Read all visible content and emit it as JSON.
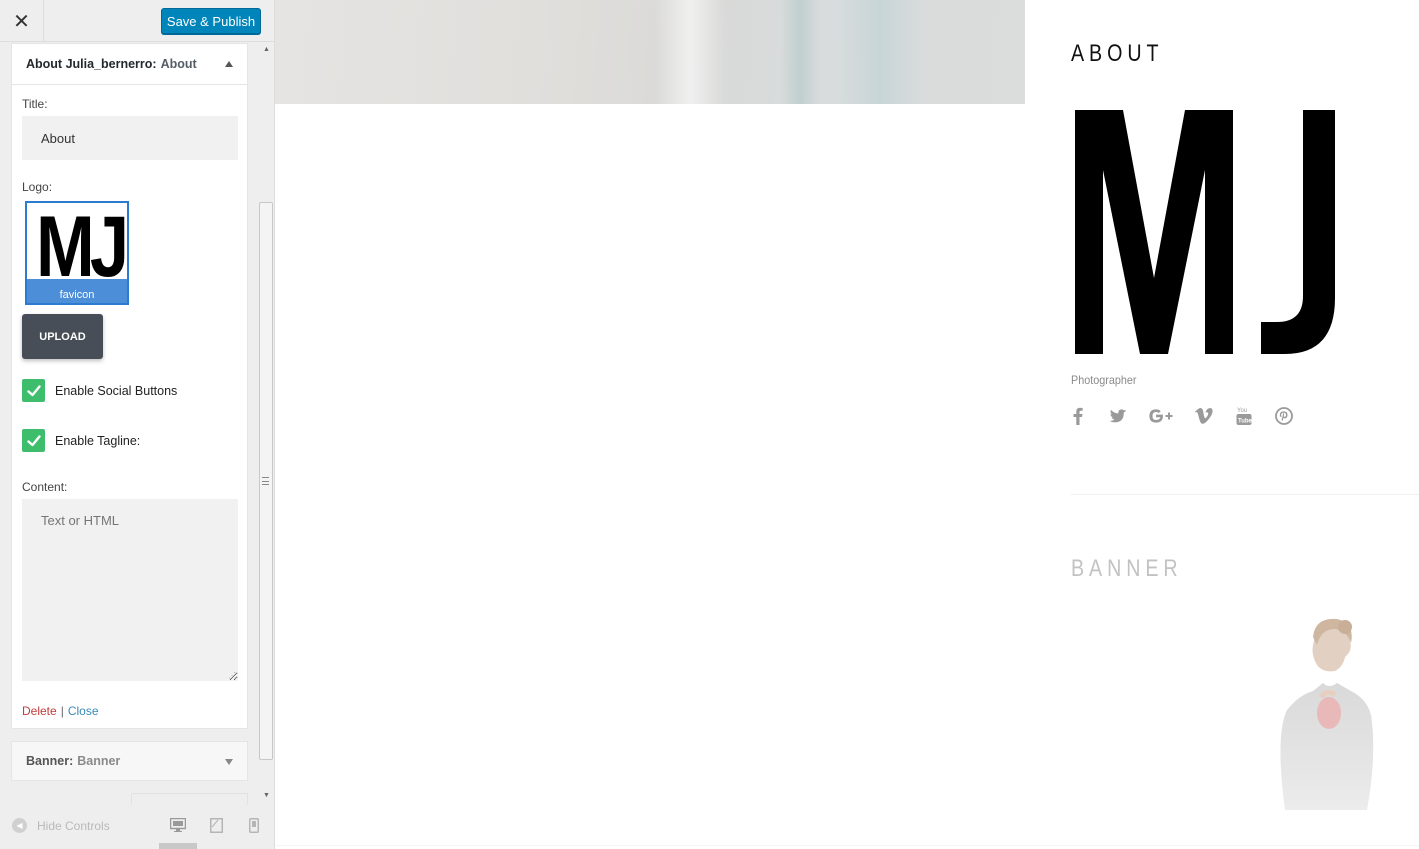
{
  "topbar": {
    "close_symbol": "✕",
    "save_label": "Save & Publish"
  },
  "widget": {
    "header_bold": "About Julia_bernerro:",
    "header_title": "About",
    "title_label": "Title:",
    "title_value": "About",
    "logo_label": "Logo:",
    "logo_text": "MJ",
    "logo_caption": "favicon",
    "upload_label": "UPLOAD",
    "social_checkbox_label": "Enable Social Buttons",
    "tagline_checkbox_label": "Enable Tagline:",
    "content_label": "Content:",
    "content_placeholder": "Text or HTML",
    "delete_label": "Delete",
    "separator": "|",
    "close_label": "Close"
  },
  "banner_widget": {
    "header_bold": "Banner:",
    "header_title": "Banner"
  },
  "footer": {
    "hide_controls_label": "Hide Controls"
  },
  "preview": {
    "about_title": "ABOUT",
    "logo_text": "MJ",
    "tagline": "Photographer",
    "social_icons": [
      "facebook-icon",
      "twitter-icon",
      "google-plus-icon",
      "vimeo-icon",
      "youtube-icon",
      "pinterest-icon"
    ],
    "banner_title": "BANNER"
  },
  "colors": {
    "primary_button": "#0085ba",
    "checkbox_green": "#3ebe6d",
    "upload_button": "#474e57",
    "delete_link": "#c43b3b",
    "close_link": "#3a8ab8"
  }
}
